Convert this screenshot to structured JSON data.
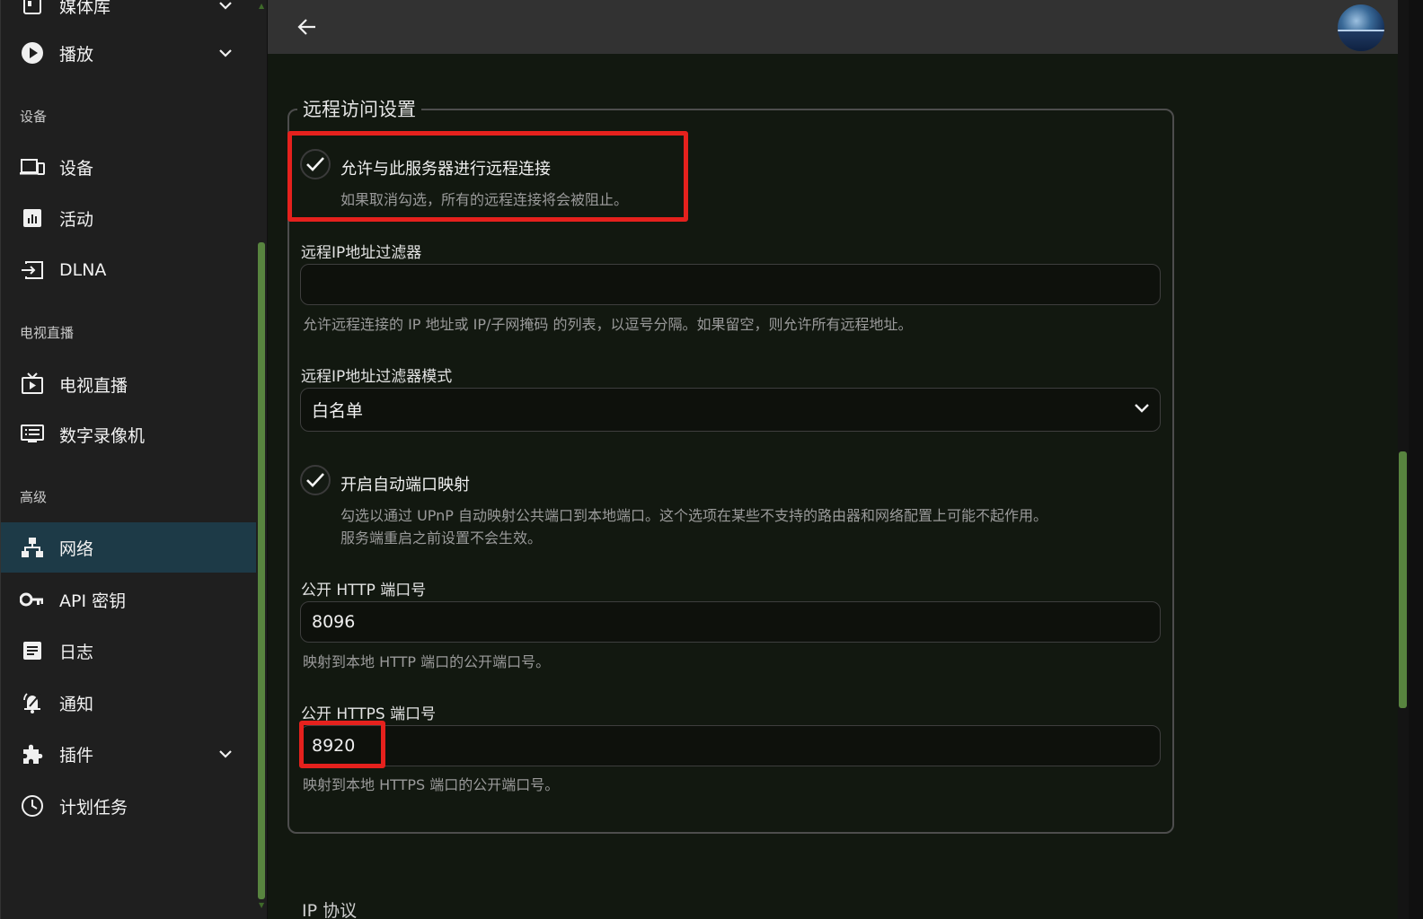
{
  "sidebar": {
    "items": {
      "media_library": {
        "label": "媒体库",
        "icon": "library-icon"
      },
      "playback": {
        "label": "播放",
        "icon": "play-icon"
      },
      "devices": {
        "label": "设备",
        "icon": "devices-icon"
      },
      "activity": {
        "label": "活动",
        "icon": "activity-icon"
      },
      "dlna": {
        "label": "DLNA",
        "icon": "dlna-icon"
      },
      "live_tv": {
        "label": "电视直播",
        "icon": "live-tv-icon"
      },
      "dvr": {
        "label": "数字录像机",
        "icon": "dvr-icon"
      },
      "network": {
        "label": "网络",
        "icon": "network-icon",
        "active": true
      },
      "api_keys": {
        "label": "API 密钥",
        "icon": "key-icon"
      },
      "logs": {
        "label": "日志",
        "icon": "logs-icon"
      },
      "notifications": {
        "label": "通知",
        "icon": "notification-icon"
      },
      "plugins": {
        "label": "插件",
        "icon": "plugin-icon"
      },
      "scheduled_tasks": {
        "label": "计划任务",
        "icon": "clock-icon"
      }
    },
    "sections": {
      "devices": "设备",
      "live_tv": "电视直播",
      "advanced": "高级"
    }
  },
  "header": {
    "back_icon": "back-arrow-icon",
    "avatar": "user-avatar"
  },
  "remote_access": {
    "legend": "远程访问设置",
    "allow_remote": {
      "checked": true,
      "label": "允许与此服务器进行远程连接",
      "helper": "如果取消勾选，所有的远程连接将会被阻止。"
    },
    "ip_filter": {
      "label": "远程IP地址过滤器",
      "value": "",
      "helper": "允许远程连接的 IP 地址或 IP/子网掩码 的列表，以逗号分隔。如果留空，则允许所有远程地址。"
    },
    "ip_filter_mode": {
      "label": "远程IP地址过滤器模式",
      "value": "白名单"
    },
    "upnp": {
      "checked": true,
      "label": "开启自动端口映射",
      "helper_line1": "勾选以通过 UPnP 自动映射公共端口到本地端口。这个选项在某些不支持的路由器和网络配置上可能不起作用。",
      "helper_line2": "服务端重启之前设置不会生效。"
    },
    "http_port": {
      "label": "公开 HTTP 端口号",
      "value": "8096",
      "helper": "映射到本地 HTTP 端口的公开端口号。"
    },
    "https_port": {
      "label": "公开 HTTPS 端口号",
      "value": "8920",
      "helper": "映射到本地 HTTPS 端口的公开端口号。"
    }
  },
  "next_section": {
    "legend_partial": "IP 协议"
  },
  "colors": {
    "highlight": "#e5211d",
    "accent": "#58843f",
    "active_nav": "#1d3a47"
  }
}
